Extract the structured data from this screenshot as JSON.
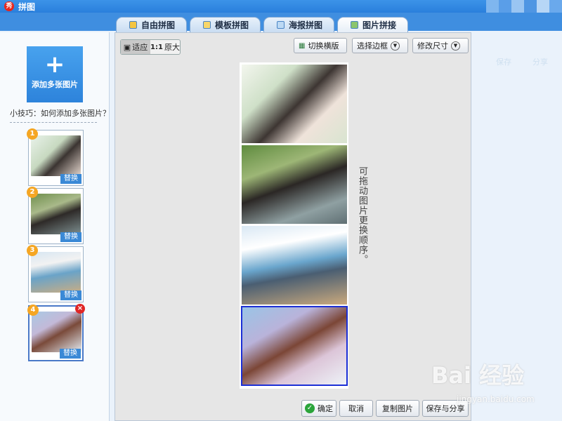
{
  "app": {
    "logo_text": "秀",
    "title": "拼图"
  },
  "tabs": [
    {
      "label": "自由拼图",
      "active": false,
      "icon": "free-collage-icon"
    },
    {
      "label": "模板拼图",
      "active": false,
      "icon": "template-icon"
    },
    {
      "label": "海报拼图",
      "active": false,
      "icon": "poster-icon"
    },
    {
      "label": "图片拼接",
      "active": true,
      "icon": "stitch-icon"
    }
  ],
  "left": {
    "add_button": {
      "plus": "+",
      "label": "添加多张图片"
    },
    "tip": "小技巧：如何添加多张图片？",
    "thumbnails": [
      {
        "number": "1",
        "replace": "替换",
        "selected": false
      },
      {
        "number": "2",
        "replace": "替换",
        "selected": false
      },
      {
        "number": "3",
        "replace": "替换",
        "selected": false
      },
      {
        "number": "4",
        "replace": "替换",
        "selected": true,
        "delete": "×"
      }
    ]
  },
  "toolbar": {
    "fit": "适应",
    "original_icon": "1:1",
    "original": "原大",
    "switch_layout": "切换横版",
    "select_border": "选择边框",
    "resize": "修改尺寸"
  },
  "hint_text": "可拖动图片更换顺序。",
  "bottom": {
    "confirm": "确定",
    "cancel": "取消",
    "copy": "复制图片",
    "save_share": "保存与分享"
  },
  "right": {
    "faint_tab_1": "保存",
    "faint_tab_2": "分享"
  },
  "watermark": {
    "main": "Bai 经验",
    "sub": "jingyan.baidu.com"
  },
  "colors": {
    "accent": "#2d83db",
    "title_bar": "#3c93e8",
    "selection": "#1c2fd6",
    "delete": "#e02525",
    "badge": "#f5a623"
  }
}
